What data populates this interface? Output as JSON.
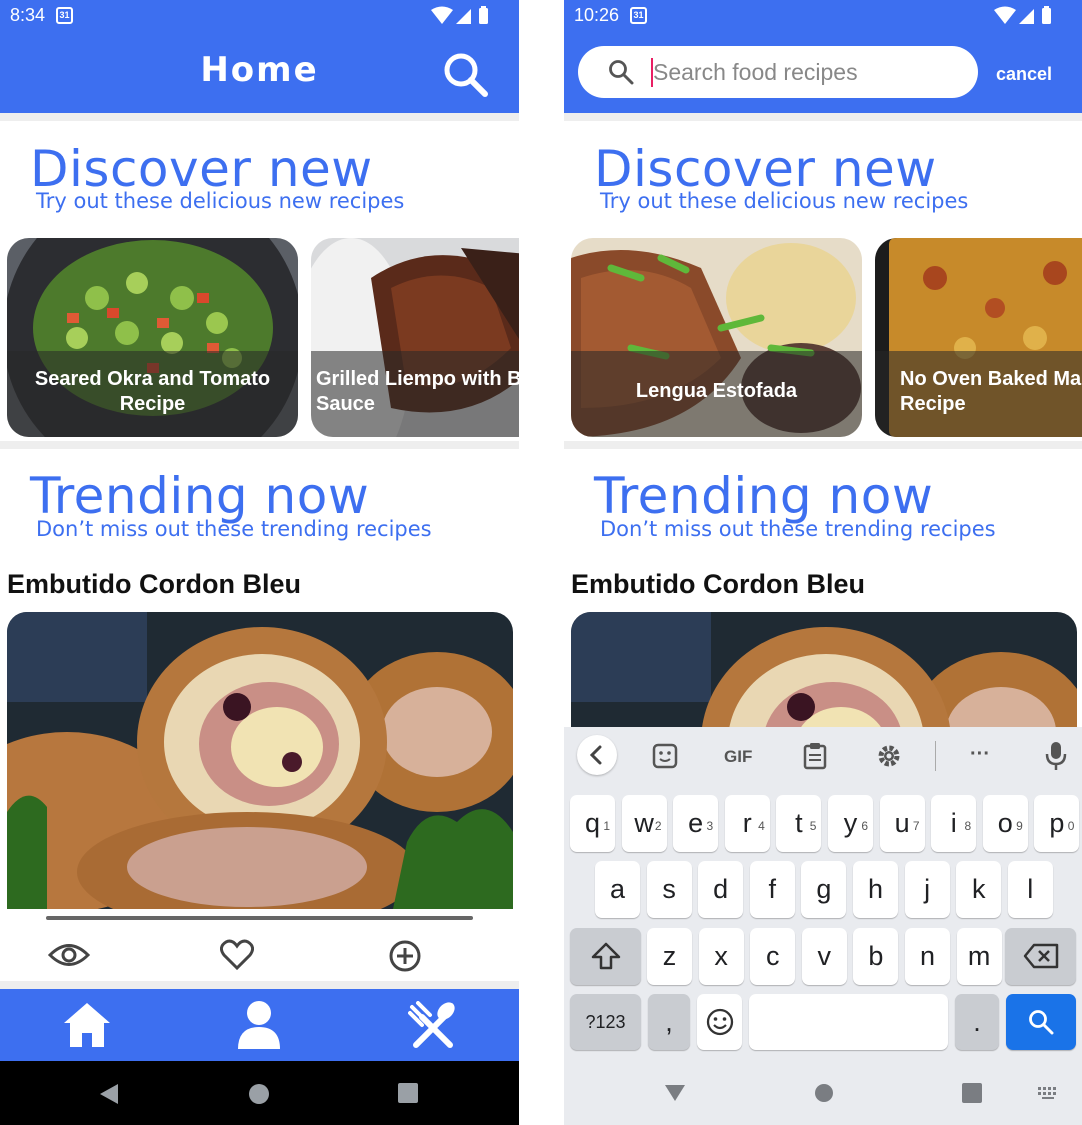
{
  "left_screen": {
    "status": {
      "time": "8:34",
      "calendar": "31"
    },
    "header": {
      "title": "Home"
    },
    "discover": {
      "title": "Discover new",
      "subtitle": "Try out these delicious new recipes"
    },
    "cards": [
      {
        "label": "Seared Okra and Tomato\nRecipe"
      },
      {
        "label": "Grilled Liempo with B\nSauce"
      }
    ],
    "trending": {
      "title": "Trending now",
      "subtitle": "Don’t miss out these trending recipes"
    },
    "featured": {
      "title": "Embutido Cordon Bleu"
    },
    "actions": [
      "eye-icon",
      "heart-icon",
      "add-circle-icon"
    ],
    "nav": [
      "home-icon",
      "person-icon",
      "restaurant-icon"
    ]
  },
  "right_screen": {
    "status": {
      "time": "10:26",
      "calendar": "31"
    },
    "search": {
      "placeholder": "Search food recipes",
      "cancel_label": "cancel"
    },
    "discover": {
      "title": "Discover new",
      "subtitle": "Try out these delicious new recipes"
    },
    "cards": [
      {
        "label": "Lengua Estofada"
      },
      {
        "label": "No Oven Baked Ma\nRecipe"
      }
    ],
    "trending": {
      "title": "Trending now",
      "subtitle": "Don’t miss out these trending recipes"
    },
    "featured": {
      "title": "Embutido Cordon Bleu"
    },
    "keyboard": {
      "toolbar": {
        "gif_label": "GIF",
        "more_label": "···"
      },
      "row1": [
        {
          "key": "q",
          "hint": "1"
        },
        {
          "key": "w",
          "hint": "2"
        },
        {
          "key": "e",
          "hint": "3"
        },
        {
          "key": "r",
          "hint": "4"
        },
        {
          "key": "t",
          "hint": "5"
        },
        {
          "key": "y",
          "hint": "6"
        },
        {
          "key": "u",
          "hint": "7"
        },
        {
          "key": "i",
          "hint": "8"
        },
        {
          "key": "o",
          "hint": "9"
        },
        {
          "key": "p",
          "hint": "0"
        }
      ],
      "row2": [
        "a",
        "s",
        "d",
        "f",
        "g",
        "h",
        "j",
        "k",
        "l"
      ],
      "row3": [
        "z",
        "x",
        "c",
        "v",
        "b",
        "n",
        "m"
      ],
      "symbols_label": "?123",
      "comma_label": ",",
      "period_label": "."
    }
  },
  "colors": {
    "primary": "#3d6ff0",
    "keyboard_bg": "#e9ebef",
    "search_key": "#1a73e8"
  }
}
